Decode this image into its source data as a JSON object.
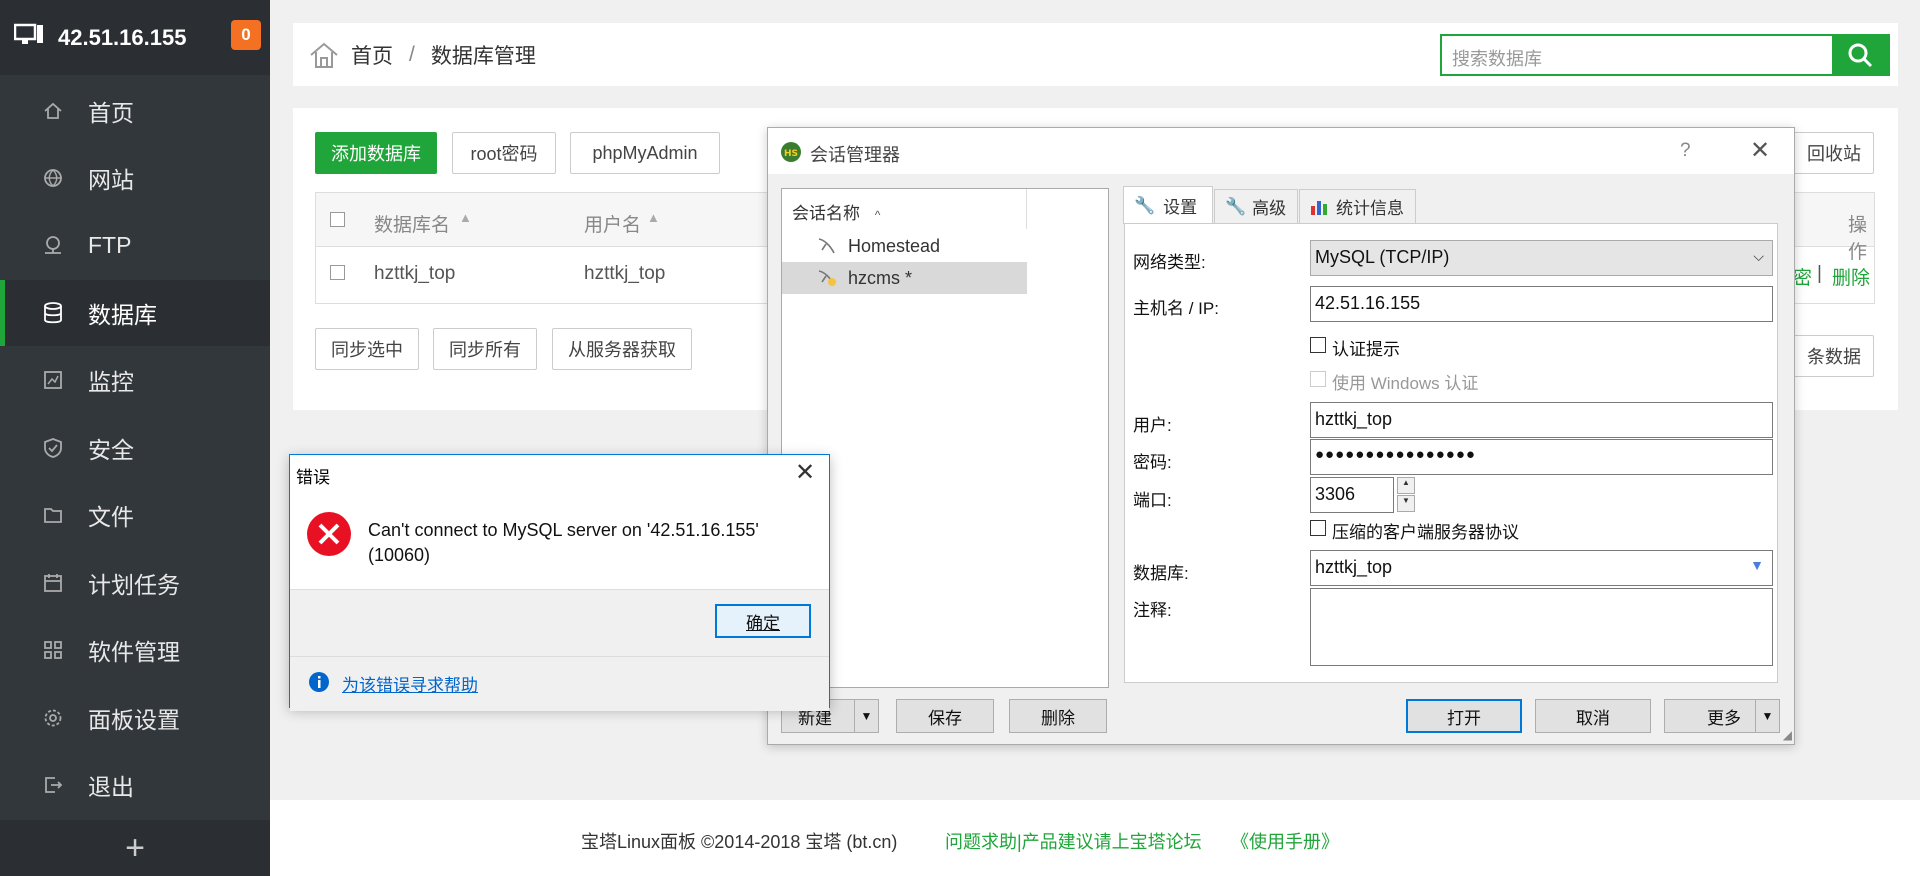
{
  "sidebar": {
    "host": "42.51.16.155",
    "badge": "0",
    "items": [
      {
        "label": "首页",
        "icon": "home-icon"
      },
      {
        "label": "网站",
        "icon": "globe-icon"
      },
      {
        "label": "FTP",
        "icon": "ftp-icon"
      },
      {
        "label": "数据库",
        "icon": "database-icon"
      },
      {
        "label": "监控",
        "icon": "monitor-icon"
      },
      {
        "label": "安全",
        "icon": "shield-icon"
      },
      {
        "label": "文件",
        "icon": "folder-icon"
      },
      {
        "label": "计划任务",
        "icon": "calendar-icon"
      },
      {
        "label": "软件管理",
        "icon": "apps-icon"
      },
      {
        "label": "面板设置",
        "icon": "gear-icon"
      },
      {
        "label": "退出",
        "icon": "logout-icon"
      }
    ],
    "active_index": 3,
    "add_label": "+"
  },
  "breadcrumb": {
    "home": "首页",
    "sep": "/",
    "current": "数据库管理"
  },
  "search": {
    "placeholder": "搜索数据库"
  },
  "toolbar": {
    "add_db": "添加数据库",
    "root_pwd": "root密码",
    "phpmyadmin": "phpMyAdmin",
    "recycle": "回收站"
  },
  "table": {
    "headers": {
      "name": "数据库名",
      "user": "用户名",
      "ops": "操作"
    },
    "rows": [
      {
        "name": "hzttkj_top",
        "user": "hzttkj_top",
        "op_partial": "密",
        "op_sep": "|",
        "op_delete": "删除"
      }
    ]
  },
  "sync": {
    "selected": "同步选中",
    "all": "同步所有",
    "from_server": "从服务器获取",
    "tail": "条数据"
  },
  "footer": {
    "copyright": "宝塔Linux面板 ©2014-2018 宝塔 (bt.cn)",
    "forum": "问题求助|产品建议请上宝塔论坛",
    "manual": "《使用手册》"
  },
  "session_manager": {
    "title": "会话管理器",
    "help": "?",
    "list_header": "会话名称",
    "sessions": [
      {
        "name": "Homestead",
        "selected": false
      },
      {
        "name": "hzcms *",
        "selected": true
      }
    ],
    "tabs": [
      "设置",
      "高级",
      "统计信息"
    ],
    "fields": {
      "net_type_label": "网络类型:",
      "net_type_value": "MySQL (TCP/IP)",
      "host_label": "主机名 / IP:",
      "host_value": "42.51.16.155",
      "auth_prompt": "认证提示",
      "win_auth": "使用 Windows 认证",
      "user_label": "用户:",
      "user_value": "hzttkj_top",
      "password_label": "密码:",
      "password_value": "●●●●●●●●●●●●●●●●",
      "port_label": "端口:",
      "port_value": "3306",
      "compress": "压缩的客户端服务器协议",
      "db_label": "数据库:",
      "db_value": "hzttkj_top",
      "notes_label": "注释:"
    },
    "buttons": {
      "new": "新建",
      "save": "保存",
      "delete": "删除",
      "open": "打开",
      "cancel": "取消",
      "more": "更多"
    }
  },
  "error_dialog": {
    "title": "错误",
    "message": "Can't connect to MySQL server on '42.51.16.155' (10060)",
    "ok": "确定",
    "help_link": "为该错误寻求帮助"
  },
  "colors": {
    "accent": "#20a53a",
    "sidebar": "#32373c",
    "badge": "#f47022",
    "error": "#e81123",
    "link": "#0066cc"
  }
}
